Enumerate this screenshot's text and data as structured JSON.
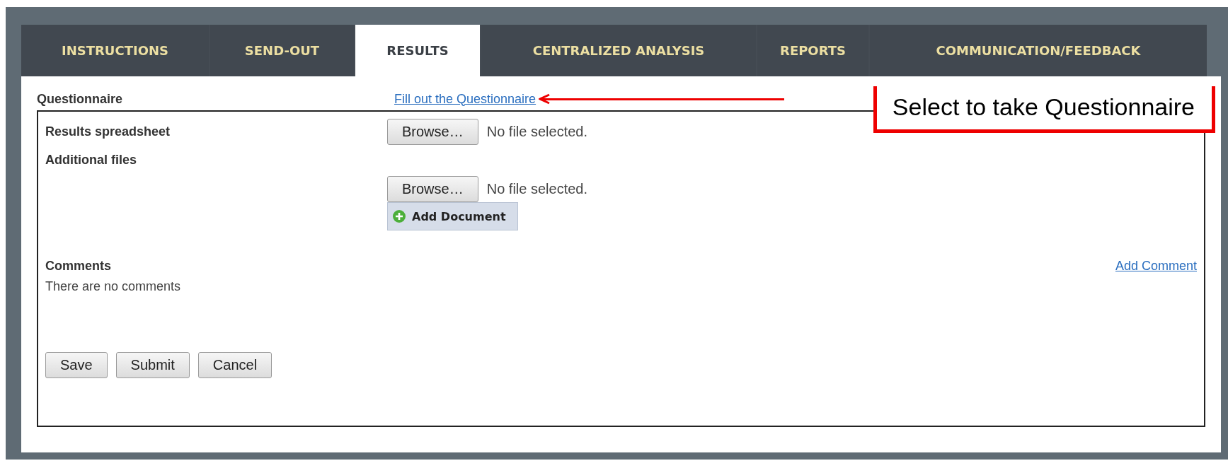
{
  "tabs": [
    {
      "label": "INSTRUCTIONS",
      "selected": false
    },
    {
      "label": "SEND-OUT",
      "selected": false
    },
    {
      "label": "RESULTS",
      "selected": true
    },
    {
      "label": "CENTRALIZED ANALYSIS",
      "selected": false
    },
    {
      "label": "REPORTS",
      "selected": false
    },
    {
      "label": "COMMUNICATION/FEEDBACK",
      "selected": false
    }
  ],
  "questionnaire": {
    "label": "Questionnaire",
    "link": "Fill out the Questionnaire"
  },
  "callout": "Select to take Questionnaire",
  "results_spreadsheet": {
    "label": "Results spreadsheet",
    "button": "Browse…",
    "status": "No file selected."
  },
  "additional_files": {
    "label": "Additional files",
    "button": "Browse…",
    "status": "No file selected.",
    "add_button": "Add Document"
  },
  "comments": {
    "label": "Comments",
    "link": "Add Comment",
    "empty": "There are no comments"
  },
  "buttons": [
    "Save",
    "Submit",
    "Cancel"
  ]
}
